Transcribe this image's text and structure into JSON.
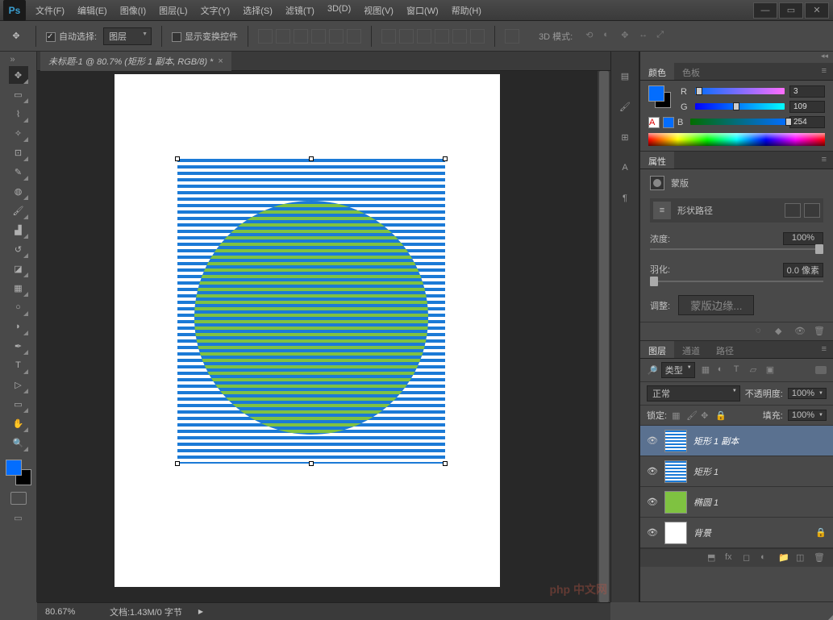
{
  "menu": [
    "文件(F)",
    "编辑(E)",
    "图像(I)",
    "图层(L)",
    "文字(Y)",
    "选择(S)",
    "滤镜(T)",
    "3D(D)",
    "视图(V)",
    "窗口(W)",
    "帮助(H)"
  ],
  "options": {
    "auto_select": "自动选择:",
    "auto_select_checked": true,
    "target": "图层",
    "show_transform": "显示变换控件",
    "mode_3d": "3D 模式:"
  },
  "doc": {
    "tab_title": "未标题-1 @ 80.7% (矩形 1 副本, RGB/8) *"
  },
  "color_panel": {
    "tab1": "颜色",
    "tab2": "色板",
    "r_label": "R",
    "g_label": "G",
    "b_label": "B",
    "r_val": "3",
    "g_val": "109",
    "b_val": "254",
    "fg": "#036dfe",
    "bg": "#000000"
  },
  "props": {
    "tab": "属性",
    "mask_title": "蒙版",
    "shape_path": "形状路径",
    "density_label": "浓度:",
    "density_val": "100%",
    "feather_label": "羽化:",
    "feather_val": "0.0 像素",
    "adjust_label": "调整:",
    "mask_edge_btn": "蒙版边缘..."
  },
  "layers_panel": {
    "tab1": "图层",
    "tab2": "通道",
    "tab3": "路径",
    "filter_type": "类型",
    "blend_mode": "正常",
    "opacity_label": "不透明度:",
    "opacity_val": "100%",
    "lock_label": "锁定:",
    "fill_label": "填充:",
    "fill_val": "100%",
    "layers": [
      {
        "name": "矩形 1 副本",
        "thumb": "stripes",
        "selected": true
      },
      {
        "name": "矩形 1",
        "thumb": "stripes",
        "selected": false
      },
      {
        "name": "椭圆 1",
        "thumb": "ellipse",
        "selected": false
      },
      {
        "name": "背景",
        "thumb": "white",
        "selected": false
      }
    ]
  },
  "status": {
    "zoom": "80.67%",
    "doc_info": "文档:1.43M/0 字节"
  },
  "watermark": "php 中文网"
}
